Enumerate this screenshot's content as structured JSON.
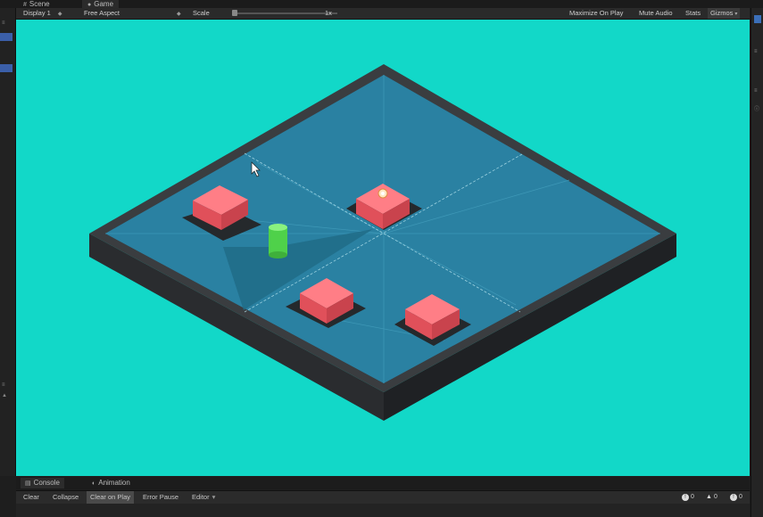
{
  "tabs": {
    "scene": "Scene",
    "game": "Game"
  },
  "toolbar": {
    "display": "Display 1",
    "aspect": "Free Aspect",
    "scale_label": "Scale",
    "scale_value": "1x",
    "maximize_on_play": "Maximize On Play",
    "mute_audio": "Mute Audio",
    "stats": "Stats",
    "gizmos": "Gizmos"
  },
  "console": {
    "tab_console": "Console",
    "tab_animation": "Animation",
    "clear": "Clear",
    "collapse": "Collapse",
    "clear_on_play": "Clear on Play",
    "error_pause": "Error Pause",
    "editor": "Editor",
    "log_count": "0",
    "warning_count": "0",
    "error_count": "0"
  },
  "colors": {
    "background": "#12d8c8",
    "board_top": "#2a81a2",
    "board_rim": "#3a3d40",
    "board_side": "#26282b",
    "box_pink": "#f0606a",
    "cylinder_green": "#4fd14a"
  }
}
